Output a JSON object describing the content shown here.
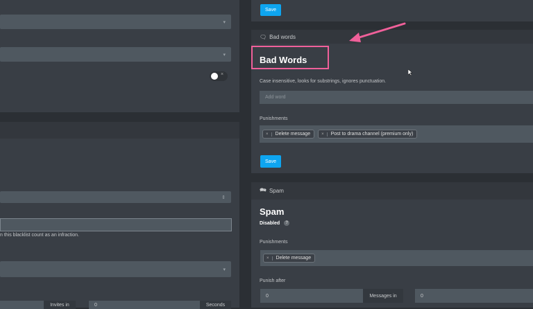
{
  "left": {
    "blacklist_help": "n this blacklist count as an infraction.",
    "invites_value": "",
    "invites_addon": "Invites in",
    "seconds_value": "0",
    "seconds_addon": "Seconds"
  },
  "right": {
    "top_save": "Save",
    "bad_words": {
      "header": "Bad words",
      "title": "Bad Words",
      "description": "Case insensitive, looks for substrings, ignores punctuation.",
      "add_word_placeholder": "Add word",
      "punishments_label": "Punishments",
      "punishments": [
        "Delete message",
        "Post to drama channel (premium only)"
      ],
      "save": "Save"
    },
    "spam": {
      "header": "Spam",
      "title": "Spam",
      "status": "Disabled",
      "punishments_label": "Punishments",
      "punishments": [
        "Delete message"
      ],
      "punish_after_label": "Punish after",
      "messages_value": "0",
      "messages_addon": "Messages in",
      "seconds_value": "0"
    }
  },
  "colors": {
    "accent": "#0ea5f0",
    "highlight": "#f0609a"
  }
}
